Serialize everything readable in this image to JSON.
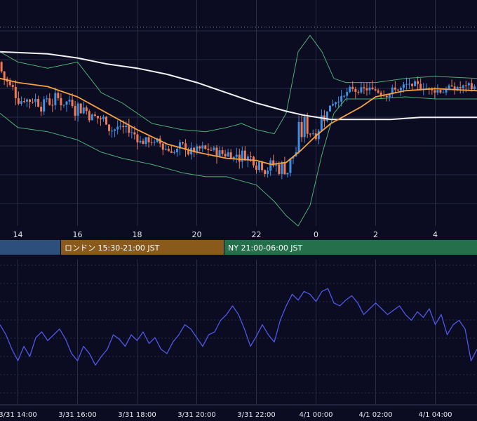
{
  "colors": {
    "background": "#0b0b22",
    "grid": "#2a2c48",
    "candle_up": "#3d8fe0",
    "candle_down": "#ef7a55",
    "ma_short": "#f5a040",
    "ma_long": "#f2f2f2",
    "bollinger": "#4caf72",
    "oscillator": "#4f58e6",
    "session_tokyo": "#2d4f7c",
    "session_london": "#8a5a1c",
    "session_ny": "#23704a"
  },
  "sessions": [
    {
      "label": "",
      "color": "#2d4f7c"
    },
    {
      "label": "ロンドン 15:30-21:00 JST",
      "color": "#8a5a1c"
    },
    {
      "label": "NY 21:00-06:00 JST",
      "color": "#23704a"
    }
  ],
  "chart_data": [
    {
      "type": "candlestick",
      "name": "price",
      "x_ticks": [
        "14",
        "16",
        "18",
        "20",
        "22",
        "0",
        "2",
        "4"
      ],
      "x_tick_hours": [
        14,
        16,
        18,
        20,
        22,
        24,
        26,
        28
      ],
      "x_range_hours": [
        13.4,
        29.4
      ],
      "y_range": [
        0,
        100
      ],
      "reference_level": 95,
      "bollinger": {
        "upper": [
          [
            13.4,
            85
          ],
          [
            14.0,
            80
          ],
          [
            15.0,
            77
          ],
          [
            16.0,
            80
          ],
          [
            16.8,
            65
          ],
          [
            17.5,
            60
          ],
          [
            18.5,
            50
          ],
          [
            19.5,
            47
          ],
          [
            20.3,
            46
          ],
          [
            21.0,
            48
          ],
          [
            21.5,
            50
          ],
          [
            22.0,
            47
          ],
          [
            22.6,
            45
          ],
          [
            23.0,
            55
          ],
          [
            23.4,
            85
          ],
          [
            23.8,
            93
          ],
          [
            24.2,
            85
          ],
          [
            24.6,
            72
          ],
          [
            25.0,
            70
          ],
          [
            26.0,
            70
          ],
          [
            27.0,
            72
          ],
          [
            28.0,
            73
          ],
          [
            29.4,
            72
          ]
        ],
        "lower": [
          [
            13.4,
            55
          ],
          [
            14.0,
            48
          ],
          [
            15.0,
            46
          ],
          [
            16.0,
            42
          ],
          [
            16.8,
            36
          ],
          [
            17.5,
            33
          ],
          [
            18.5,
            30
          ],
          [
            19.5,
            26
          ],
          [
            20.3,
            24
          ],
          [
            21.0,
            24
          ],
          [
            21.5,
            22
          ],
          [
            22.0,
            20
          ],
          [
            22.6,
            12
          ],
          [
            23.0,
            5
          ],
          [
            23.4,
            0
          ],
          [
            23.8,
            10
          ],
          [
            24.2,
            35
          ],
          [
            24.6,
            55
          ],
          [
            25.0,
            62
          ],
          [
            26.0,
            62
          ],
          [
            27.0,
            63
          ],
          [
            28.0,
            62
          ],
          [
            29.4,
            62
          ]
        ]
      },
      "ma_short": [
        [
          13.4,
          72
        ],
        [
          14.0,
          70
        ],
        [
          15.0,
          68
        ],
        [
          16.0,
          63
        ],
        [
          17.0,
          55
        ],
        [
          18.0,
          47
        ],
        [
          19.0,
          40
        ],
        [
          20.0,
          36
        ],
        [
          21.0,
          33
        ],
        [
          22.0,
          32
        ],
        [
          22.5,
          30
        ],
        [
          23.0,
          31
        ],
        [
          23.5,
          37
        ],
        [
          24.0,
          44
        ],
        [
          24.5,
          50
        ],
        [
          25.0,
          54
        ],
        [
          25.5,
          58
        ],
        [
          26.0,
          63
        ],
        [
          27.0,
          66
        ],
        [
          28.0,
          67
        ],
        [
          29.4,
          66
        ]
      ],
      "ma_long": [
        [
          13.4,
          85
        ],
        [
          15.0,
          84
        ],
        [
          16.0,
          82
        ],
        [
          17.0,
          79
        ],
        [
          18.0,
          77
        ],
        [
          19.0,
          74
        ],
        [
          20.0,
          70
        ],
        [
          21.0,
          65
        ],
        [
          22.0,
          60
        ],
        [
          23.0,
          56
        ],
        [
          23.6,
          54
        ],
        [
          24.5,
          52
        ],
        [
          25.5,
          52
        ],
        [
          26.5,
          52
        ],
        [
          27.5,
          53
        ],
        [
          28.5,
          53
        ],
        [
          29.4,
          53
        ]
      ]
    },
    {
      "type": "line",
      "name": "oscillator",
      "x_ticks": [
        "3/31 14:00",
        "3/31 16:00",
        "3/31 18:00",
        "3/31 20:00",
        "3/31 22:00",
        "4/1 00:00",
        "4/1 02:00",
        "4/1 04:00"
      ],
      "x_tick_hours": [
        14,
        16,
        18,
        20,
        22,
        24,
        26,
        28
      ],
      "x_range_hours": [
        13.4,
        29.4
      ],
      "y_range": [
        0,
        100
      ],
      "points": [
        [
          13.4,
          55
        ],
        [
          13.6,
          48
        ],
        [
          13.8,
          38
        ],
        [
          14.0,
          30
        ],
        [
          14.2,
          40
        ],
        [
          14.4,
          33
        ],
        [
          14.6,
          46
        ],
        [
          14.8,
          50
        ],
        [
          15.0,
          44
        ],
        [
          15.2,
          48
        ],
        [
          15.4,
          52
        ],
        [
          15.6,
          45
        ],
        [
          15.8,
          35
        ],
        [
          16.0,
          30
        ],
        [
          16.2,
          40
        ],
        [
          16.4,
          35
        ],
        [
          16.6,
          27
        ],
        [
          16.8,
          33
        ],
        [
          17.0,
          38
        ],
        [
          17.2,
          48
        ],
        [
          17.4,
          45
        ],
        [
          17.6,
          40
        ],
        [
          17.8,
          48
        ],
        [
          18.0,
          44
        ],
        [
          18.2,
          50
        ],
        [
          18.4,
          42
        ],
        [
          18.6,
          46
        ],
        [
          18.8,
          38
        ],
        [
          19.0,
          35
        ],
        [
          19.2,
          43
        ],
        [
          19.4,
          48
        ],
        [
          19.6,
          55
        ],
        [
          19.8,
          52
        ],
        [
          20.0,
          46
        ],
        [
          20.2,
          40
        ],
        [
          20.4,
          48
        ],
        [
          20.6,
          50
        ],
        [
          20.8,
          58
        ],
        [
          21.0,
          62
        ],
        [
          21.2,
          68
        ],
        [
          21.4,
          62
        ],
        [
          21.6,
          52
        ],
        [
          21.8,
          40
        ],
        [
          22.0,
          47
        ],
        [
          22.2,
          55
        ],
        [
          22.4,
          48
        ],
        [
          22.6,
          43
        ],
        [
          22.8,
          58
        ],
        [
          23.0,
          68
        ],
        [
          23.2,
          76
        ],
        [
          23.4,
          72
        ],
        [
          23.6,
          78
        ],
        [
          23.8,
          76
        ],
        [
          24.0,
          71
        ],
        [
          24.2,
          78
        ],
        [
          24.4,
          80
        ],
        [
          24.6,
          70
        ],
        [
          24.8,
          68
        ],
        [
          25.0,
          72
        ],
        [
          25.2,
          75
        ],
        [
          25.4,
          70
        ],
        [
          25.6,
          62
        ],
        [
          25.8,
          66
        ],
        [
          26.0,
          70
        ],
        [
          26.2,
          66
        ],
        [
          26.4,
          62
        ],
        [
          26.6,
          65
        ],
        [
          26.8,
          68
        ],
        [
          27.0,
          62
        ],
        [
          27.2,
          58
        ],
        [
          27.4,
          64
        ],
        [
          27.6,
          60
        ],
        [
          27.8,
          66
        ],
        [
          28.0,
          55
        ],
        [
          28.2,
          62
        ],
        [
          28.4,
          48
        ],
        [
          28.6,
          55
        ],
        [
          28.8,
          58
        ],
        [
          29.0,
          52
        ],
        [
          29.2,
          30
        ],
        [
          29.4,
          38
        ]
      ]
    }
  ]
}
